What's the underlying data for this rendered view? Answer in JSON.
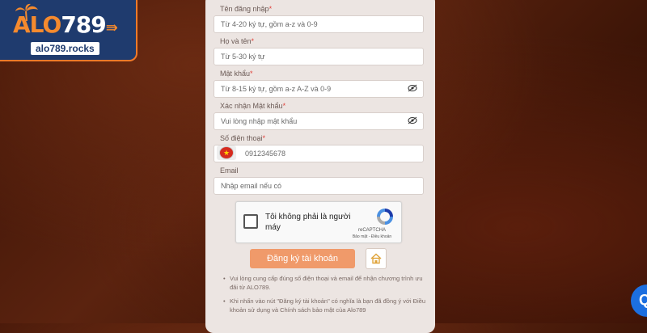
{
  "brand": {
    "logo_alo": "ALO",
    "logo_num": "789",
    "url": "alo789.rocks",
    "colors": {
      "orange": "#f58a2e",
      "navy": "#1f3b6e"
    }
  },
  "form": {
    "username": {
      "label": "Tên đăng nhập",
      "required": "*",
      "placeholder": "Từ 4-20 ký tự, gồm a-z và 0-9"
    },
    "fullname": {
      "label": "Họ và tên",
      "required": "*",
      "placeholder": "Từ 5-30 ký tự"
    },
    "password": {
      "label": "Mật khẩu",
      "required": "*",
      "placeholder": "Từ 8-15 ký tự, gồm a-z A-Z và 0-9"
    },
    "confirm_password": {
      "label": "Xác nhận Mật khẩu",
      "required": "*",
      "placeholder": "Vui lòng nhập mật khẩu"
    },
    "phone": {
      "label": "Số điện thoại",
      "required": "*",
      "placeholder": "0912345678",
      "flag": "★"
    },
    "email": {
      "label": "Email",
      "placeholder": "Nhập email nếu có"
    }
  },
  "recaptcha": {
    "text": "Tôi không phải là người máy",
    "brand": "reCAPTCHA",
    "links": "Bảo mật - Điều khoản"
  },
  "buttons": {
    "submit": "Đăng ký tài khoản",
    "chat_icon": "Q"
  },
  "notes": [
    "Vui lòng cung cấp đúng số điện thoại và email để nhận chương trình ưu đãi từ ALO789.",
    "Khi nhấn vào nút \"Đăng ký tài khoản\" có nghĩa là bạn đã đồng ý với Điều khoản sử dụng và Chính sách bảo mật của Alo789"
  ]
}
